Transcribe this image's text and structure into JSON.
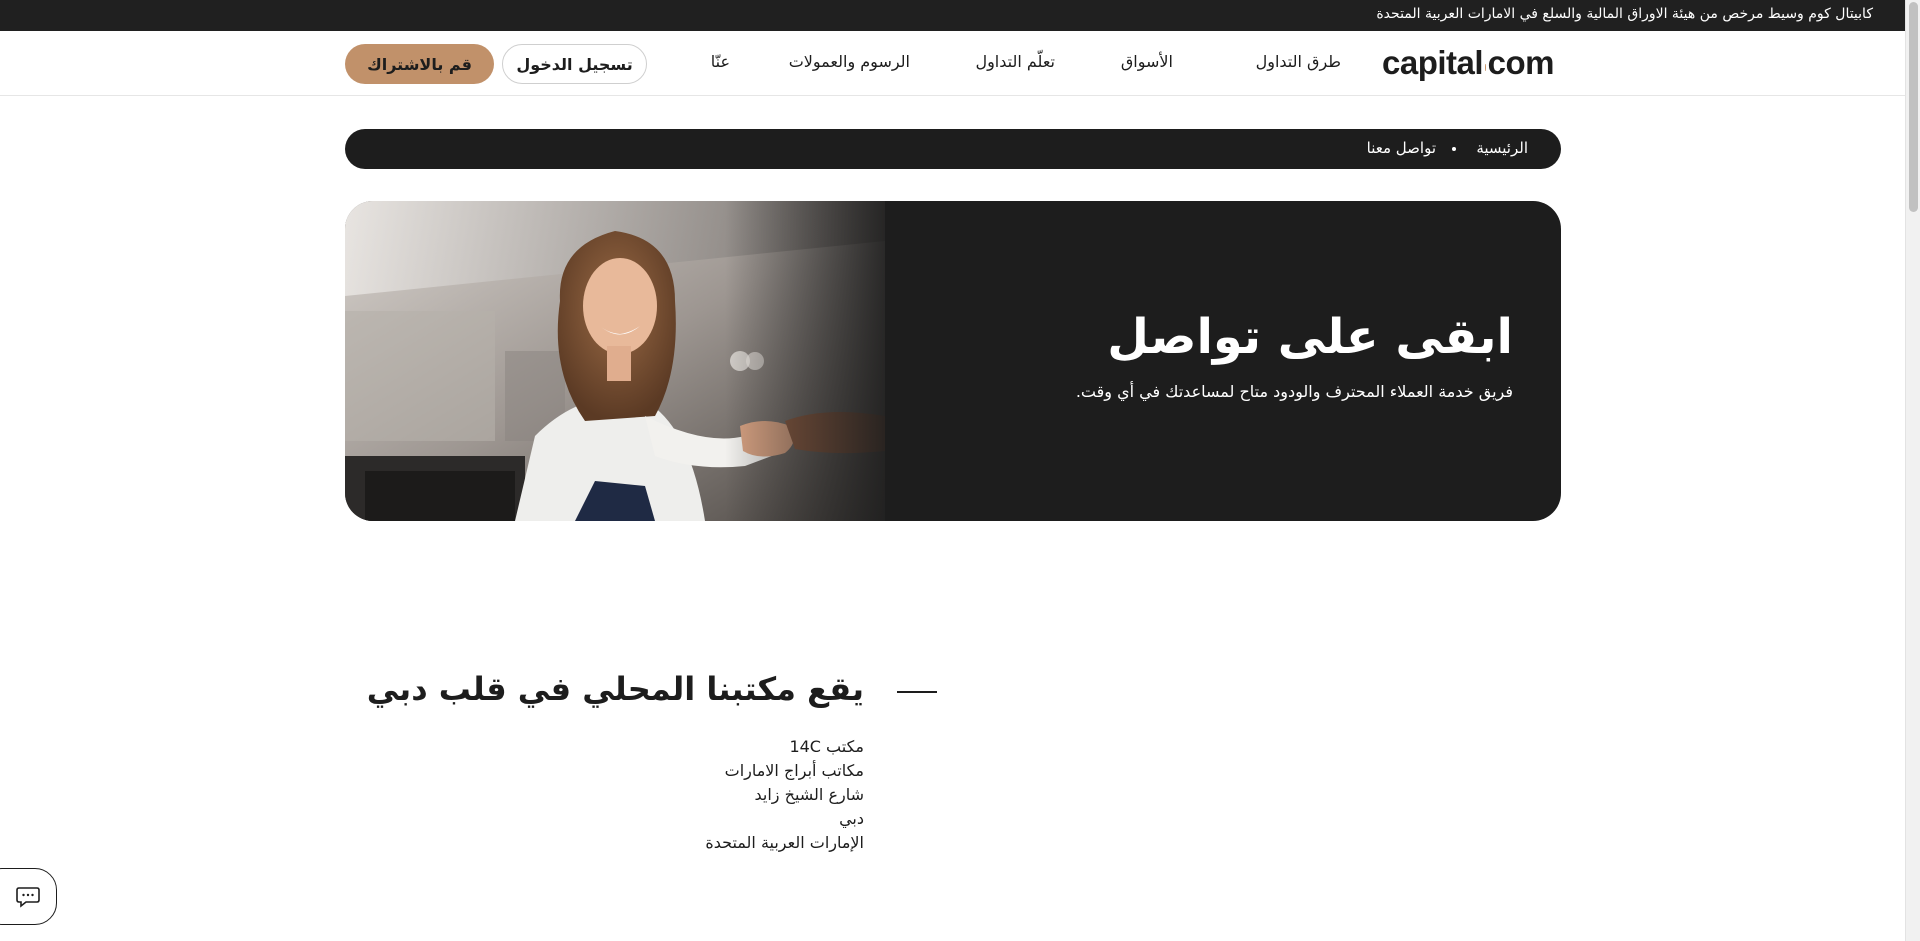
{
  "topbar": {
    "text": "كابيتال كوم وسيط مرخص من هيئة الاوراق المالية والسلع في الامارات العربية المتحدة"
  },
  "header": {
    "logo_left": "capital",
    "logo_right": "com",
    "nav": [
      {
        "label": "طرق التداول"
      },
      {
        "label": "الأسواق"
      },
      {
        "label": "تعلّم التداول"
      },
      {
        "label": "الرسوم والعمولات"
      },
      {
        "label": "عنّا"
      }
    ],
    "login_label": "تسجيل الدخول",
    "signup_label": "قم بالاشتراك"
  },
  "breadcrumb": {
    "home": "الرئيسية",
    "current": "تواصل معنا"
  },
  "hero": {
    "title": "ابقى على تواصل",
    "subtitle": "فريق خدمة العملاء المحترف والودود متاح لمساعدتك في أي وقت."
  },
  "office": {
    "title": "يقع مكتبنا المحلي في قلب دبي",
    "address": [
      "مكتب 14C",
      "مكاتب أبراج الامارات",
      "شارع الشيخ زايد",
      "دبي",
      "الإمارات العربية المتحدة"
    ]
  },
  "icons": {
    "chat": "chat-icon"
  },
  "colors": {
    "dark": "#1d1d1d",
    "accent": "#c1916a"
  }
}
